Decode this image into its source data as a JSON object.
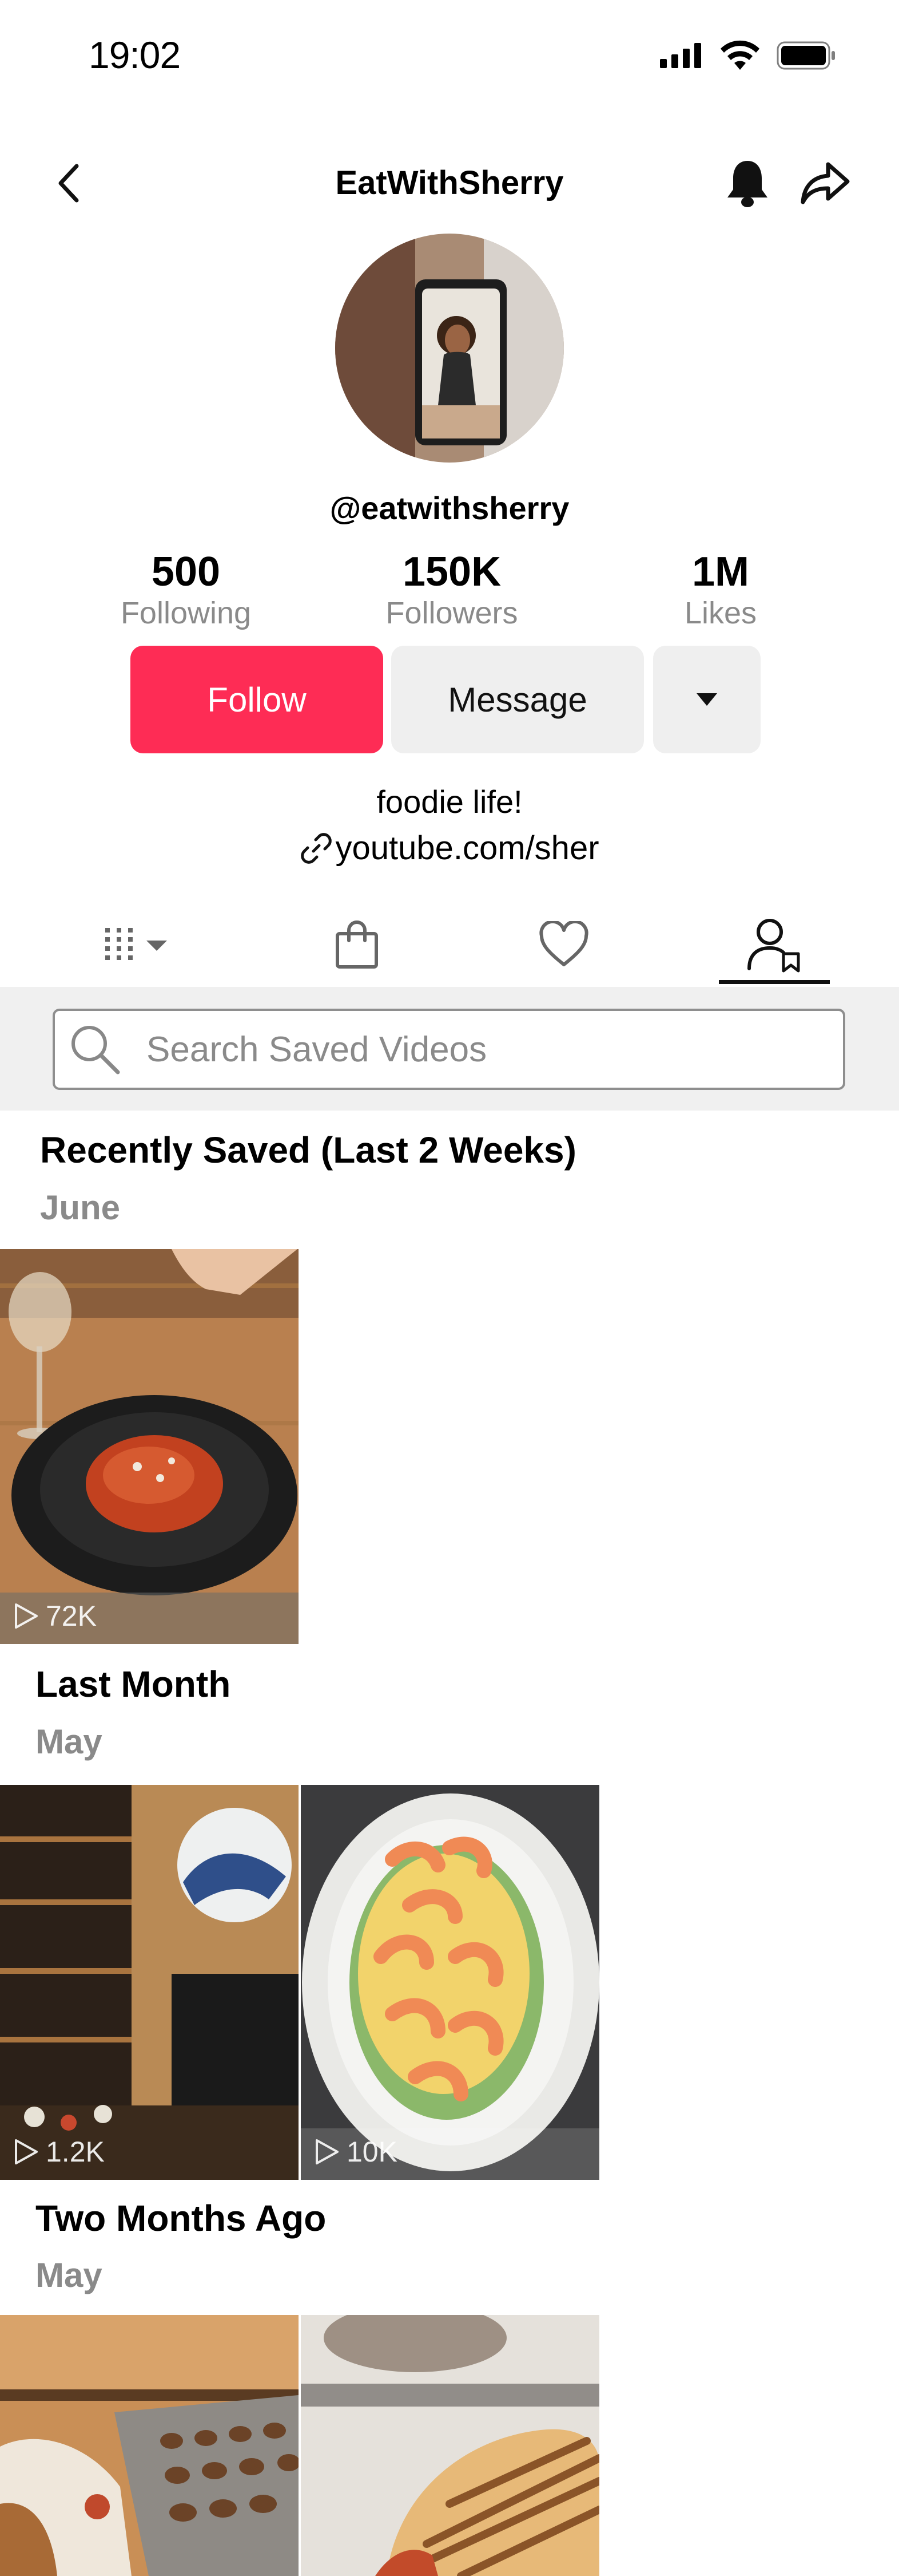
{
  "status_bar": {
    "time": "19:02"
  },
  "header": {
    "title": "EatWithSherry"
  },
  "profile": {
    "handle": "@eatwithsherry",
    "stats": [
      {
        "value": "500",
        "label": "Following"
      },
      {
        "value": "150K",
        "label": "Followers"
      },
      {
        "value": "1M",
        "label": "Likes"
      }
    ],
    "buttons": {
      "follow": "Follow",
      "message": "Message"
    },
    "bio": "foodie life!",
    "link": "youtube.com/sher"
  },
  "tabs": {
    "items": [
      "videos-grid-icon",
      "shop-bag-icon",
      "heart-icon",
      "saved-user-icon"
    ],
    "active_index": 3
  },
  "search": {
    "placeholder": "Search Saved Videos"
  },
  "sections": [
    {
      "title": "Recently Saved (Last 2 Weeks)",
      "subtitle": "June",
      "videos": [
        {
          "views": "72K",
          "theme": "pasta"
        }
      ]
    },
    {
      "title": "Last Month",
      "subtitle": "May",
      "videos": [
        {
          "views": "1.2K",
          "theme": "restaurant"
        },
        {
          "views": "10K",
          "theme": "shrimp"
        }
      ]
    },
    {
      "title": "Two Months Ago",
      "subtitle": "May",
      "videos": [
        {
          "views": "",
          "theme": "bakery"
        },
        {
          "views": "",
          "theme": "sandwich"
        }
      ]
    }
  ],
  "colors": {
    "accent": "#fe2c55",
    "secondary_button": "#efefef",
    "muted_text": "#8a8a8a"
  }
}
